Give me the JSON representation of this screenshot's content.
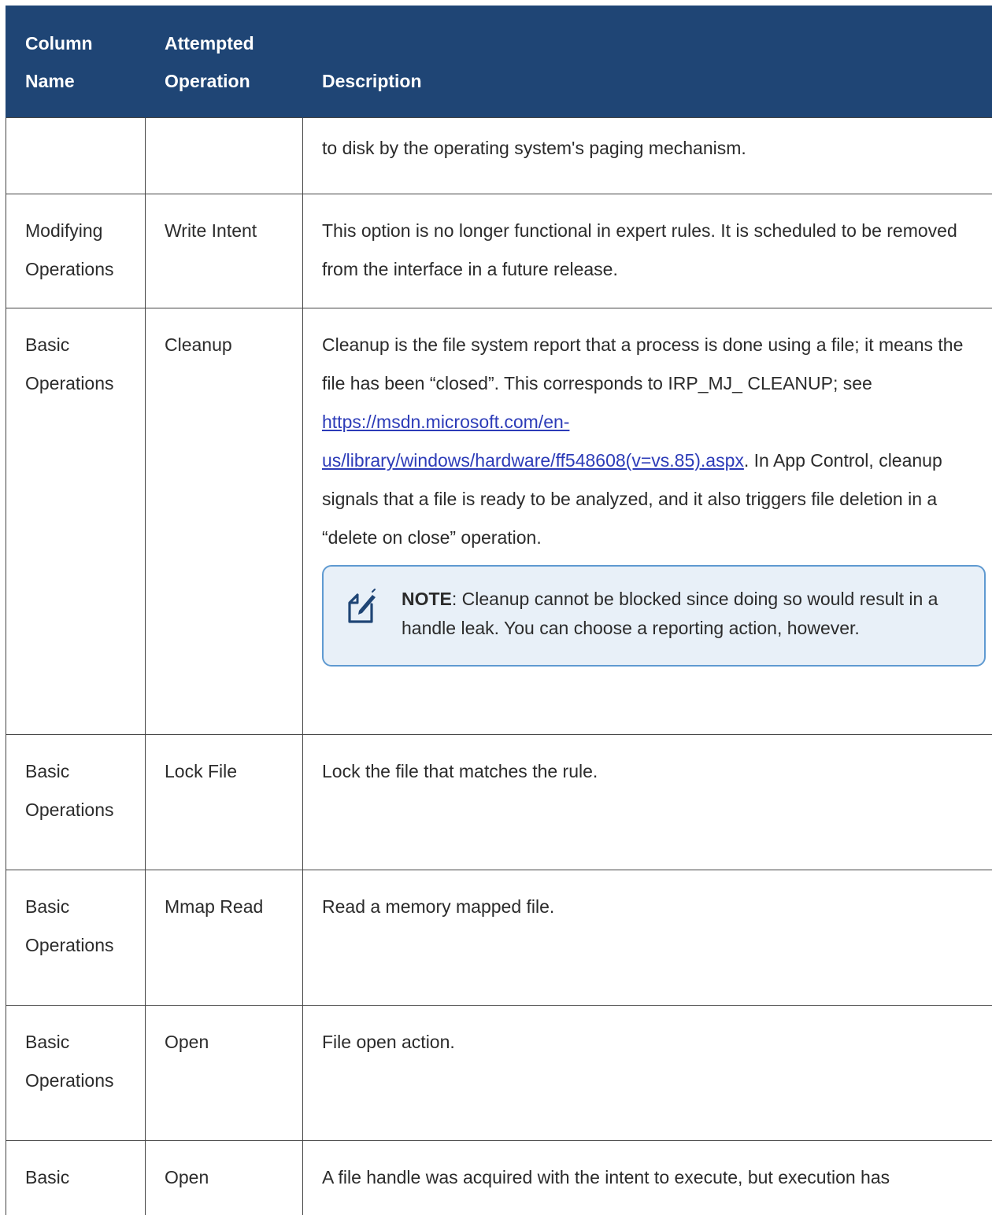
{
  "table": {
    "headers": {
      "column_name": [
        "Column",
        "Name"
      ],
      "attempted_operation": [
        "Attempted",
        "Operation"
      ],
      "description": "Description"
    },
    "rows": [
      {
        "column_name": "",
        "operation": "",
        "description": "to disk by the operating system's paging mechanism."
      },
      {
        "column_name": "Modifying Operations",
        "operation": "Write Intent",
        "description": "This option is no longer functional in expert rules. It is scheduled to be removed from the interface in a future release."
      },
      {
        "column_name": "Basic Operations",
        "operation": "Cleanup",
        "description_before_link": "Cleanup is the file system report that a process is done using a file; it means the file has been “closed”. This corresponds to IRP_MJ_ CLEANUP; see ",
        "link_text": "https://msdn.microsoft.com/en-us/library/windows/hardware/ff548608(v=vs.85).aspx",
        "description_after_link": ". In App Control, cleanup signals that a file is ready to be analyzed, and it also triggers file deletion in a “delete on close” operation.",
        "note": {
          "icon": "note-edit-icon",
          "label": "NOTE",
          "text": ": Cleanup cannot be blocked since doing so would result in a handle leak. You can choose a reporting action, however."
        }
      },
      {
        "column_name": "Basic Operations",
        "operation": "Lock File",
        "description": "Lock the file that matches the rule."
      },
      {
        "column_name": "Basic Operations",
        "operation": "Mmap Read",
        "description": "Read a memory mapped file."
      },
      {
        "column_name": "Basic Operations",
        "operation": "Open",
        "description": "File open action."
      },
      {
        "column_name": "Basic",
        "operation": "Open",
        "description": "A file handle was acquired with the intent to execute, but execution has"
      }
    ]
  },
  "colors": {
    "header_bg": "#1f4575",
    "header_text": "#ffffff",
    "link": "#2c3bb8",
    "note_border": "#5f9ad1",
    "note_bg": "#e8f0f8"
  }
}
